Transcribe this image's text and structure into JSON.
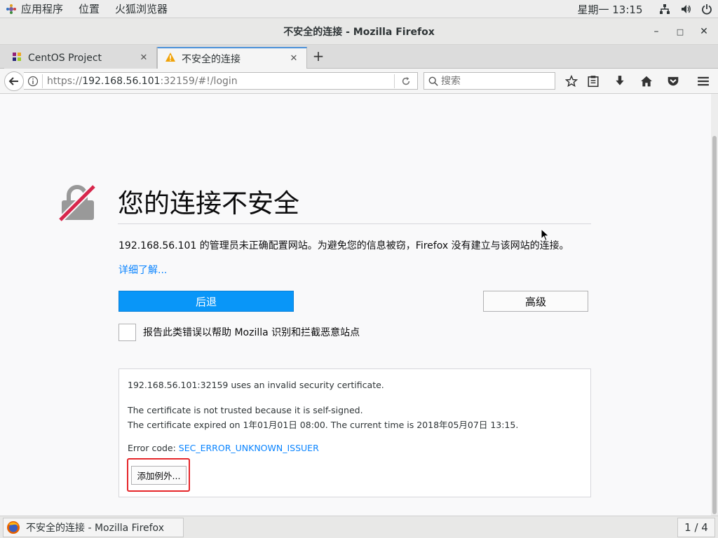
{
  "topbar": {
    "apps_label": "应用程序",
    "places_label": "位置",
    "firefox_label": "火狐浏览器",
    "clock": "星期一 13:15"
  },
  "window": {
    "title": "不安全的连接 - Mozilla Firefox",
    "minimize": "–",
    "maximize": "□",
    "close": "✕"
  },
  "tabs": [
    {
      "title": "CentOS Project",
      "close": "✕",
      "active": false
    },
    {
      "title": "不安全的连接",
      "close": "✕",
      "active": true
    }
  ],
  "newtab_label": "+",
  "navbar": {
    "url_scheme": "https://",
    "url_host": "192.168.56.101",
    "url_rest": ":32159/#!/login",
    "search_placeholder": "搜索"
  },
  "error": {
    "title": "您的连接不安全",
    "description": "192.168.56.101 的管理员未正确配置网站。为避免您的信息被窃，Firefox 没有建立与该网站的连接。",
    "learn_more": "详细了解...",
    "back_button": "后退",
    "advanced_button": "高级",
    "report_label": "报告此类错误以帮助 Mozilla 识别和拦截恶意站点"
  },
  "advanced": {
    "line1": "192.168.56.101:32159 uses an invalid security certificate.",
    "line2": "The certificate is not trusted because it is self-signed.",
    "line3": "The certificate expired on 1年01月01日 08:00. The current time is 2018年05月07日 13:15.",
    "error_code_label": "Error code: ",
    "error_code": "SEC_ERROR_UNKNOWN_ISSUER",
    "add_exception": "添加例外..."
  },
  "taskbar": {
    "window_label": "不安全的连接 - Mozilla Firefox",
    "pager": "1 / 4"
  },
  "colors": {
    "primary_button": "#0996f8",
    "link": "#0a84ff",
    "highlight_box": "#e5262a",
    "lock_strike": "#d7264b"
  }
}
